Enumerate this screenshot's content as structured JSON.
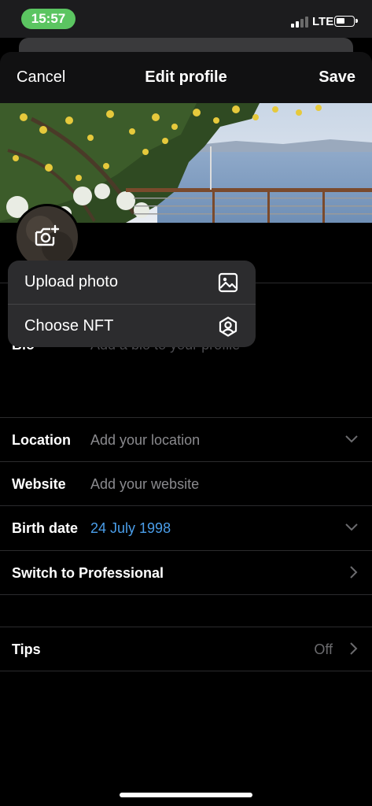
{
  "status_bar": {
    "time": "15:57",
    "network": "LTE",
    "signal_bars": 2,
    "battery_level": 0.45
  },
  "nav": {
    "cancel": "Cancel",
    "title": "Edit profile",
    "save": "Save"
  },
  "fields": {
    "bio": {
      "label": "Bio",
      "placeholder": "Add a bio to your profile"
    },
    "location": {
      "label": "Location",
      "placeholder": "Add your location"
    },
    "website": {
      "label": "Website",
      "placeholder": "Add your website"
    },
    "birth_date": {
      "label": "Birth date",
      "value": "24 July 1998"
    },
    "professional": {
      "label": "Switch to Professional"
    },
    "tips": {
      "label": "Tips",
      "value": "Off"
    }
  },
  "photo_menu": {
    "items": [
      {
        "label": "Upload photo",
        "icon": "image-icon"
      },
      {
        "label": "Choose NFT",
        "icon": "hexagon-avatar-icon"
      }
    ]
  },
  "colors": {
    "accent_blue": "#4a9eea",
    "status_green": "#5bc561",
    "menu_bg": "#2c2c2e"
  },
  "icons": {
    "avatar_button": "camera-plus-icon",
    "dropdown": "chevron-down-icon",
    "disclosure": "chevron-right-icon"
  }
}
